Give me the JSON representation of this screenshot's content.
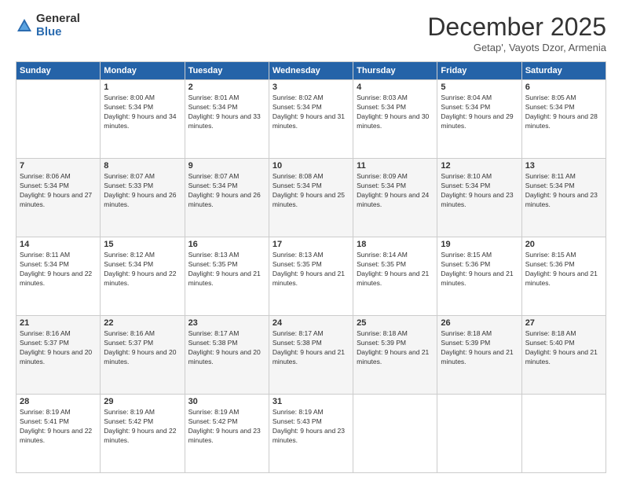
{
  "logo": {
    "general": "General",
    "blue": "Blue"
  },
  "title": "December 2025",
  "location": "Getap', Vayots Dzor, Armenia",
  "days_of_week": [
    "Sunday",
    "Monday",
    "Tuesday",
    "Wednesday",
    "Thursday",
    "Friday",
    "Saturday"
  ],
  "weeks": [
    [
      {
        "day": "",
        "sunrise": "",
        "sunset": "",
        "daylight": ""
      },
      {
        "day": "1",
        "sunrise": "Sunrise: 8:00 AM",
        "sunset": "Sunset: 5:34 PM",
        "daylight": "Daylight: 9 hours and 34 minutes."
      },
      {
        "day": "2",
        "sunrise": "Sunrise: 8:01 AM",
        "sunset": "Sunset: 5:34 PM",
        "daylight": "Daylight: 9 hours and 33 minutes."
      },
      {
        "day": "3",
        "sunrise": "Sunrise: 8:02 AM",
        "sunset": "Sunset: 5:34 PM",
        "daylight": "Daylight: 9 hours and 31 minutes."
      },
      {
        "day": "4",
        "sunrise": "Sunrise: 8:03 AM",
        "sunset": "Sunset: 5:34 PM",
        "daylight": "Daylight: 9 hours and 30 minutes."
      },
      {
        "day": "5",
        "sunrise": "Sunrise: 8:04 AM",
        "sunset": "Sunset: 5:34 PM",
        "daylight": "Daylight: 9 hours and 29 minutes."
      },
      {
        "day": "6",
        "sunrise": "Sunrise: 8:05 AM",
        "sunset": "Sunset: 5:34 PM",
        "daylight": "Daylight: 9 hours and 28 minutes."
      }
    ],
    [
      {
        "day": "7",
        "sunrise": "Sunrise: 8:06 AM",
        "sunset": "Sunset: 5:34 PM",
        "daylight": "Daylight: 9 hours and 27 minutes."
      },
      {
        "day": "8",
        "sunrise": "Sunrise: 8:07 AM",
        "sunset": "Sunset: 5:33 PM",
        "daylight": "Daylight: 9 hours and 26 minutes."
      },
      {
        "day": "9",
        "sunrise": "Sunrise: 8:07 AM",
        "sunset": "Sunset: 5:34 PM",
        "daylight": "Daylight: 9 hours and 26 minutes."
      },
      {
        "day": "10",
        "sunrise": "Sunrise: 8:08 AM",
        "sunset": "Sunset: 5:34 PM",
        "daylight": "Daylight: 9 hours and 25 minutes."
      },
      {
        "day": "11",
        "sunrise": "Sunrise: 8:09 AM",
        "sunset": "Sunset: 5:34 PM",
        "daylight": "Daylight: 9 hours and 24 minutes."
      },
      {
        "day": "12",
        "sunrise": "Sunrise: 8:10 AM",
        "sunset": "Sunset: 5:34 PM",
        "daylight": "Daylight: 9 hours and 23 minutes."
      },
      {
        "day": "13",
        "sunrise": "Sunrise: 8:11 AM",
        "sunset": "Sunset: 5:34 PM",
        "daylight": "Daylight: 9 hours and 23 minutes."
      }
    ],
    [
      {
        "day": "14",
        "sunrise": "Sunrise: 8:11 AM",
        "sunset": "Sunset: 5:34 PM",
        "daylight": "Daylight: 9 hours and 22 minutes."
      },
      {
        "day": "15",
        "sunrise": "Sunrise: 8:12 AM",
        "sunset": "Sunset: 5:34 PM",
        "daylight": "Daylight: 9 hours and 22 minutes."
      },
      {
        "day": "16",
        "sunrise": "Sunrise: 8:13 AM",
        "sunset": "Sunset: 5:35 PM",
        "daylight": "Daylight: 9 hours and 21 minutes."
      },
      {
        "day": "17",
        "sunrise": "Sunrise: 8:13 AM",
        "sunset": "Sunset: 5:35 PM",
        "daylight": "Daylight: 9 hours and 21 minutes."
      },
      {
        "day": "18",
        "sunrise": "Sunrise: 8:14 AM",
        "sunset": "Sunset: 5:35 PM",
        "daylight": "Daylight: 9 hours and 21 minutes."
      },
      {
        "day": "19",
        "sunrise": "Sunrise: 8:15 AM",
        "sunset": "Sunset: 5:36 PM",
        "daylight": "Daylight: 9 hours and 21 minutes."
      },
      {
        "day": "20",
        "sunrise": "Sunrise: 8:15 AM",
        "sunset": "Sunset: 5:36 PM",
        "daylight": "Daylight: 9 hours and 21 minutes."
      }
    ],
    [
      {
        "day": "21",
        "sunrise": "Sunrise: 8:16 AM",
        "sunset": "Sunset: 5:37 PM",
        "daylight": "Daylight: 9 hours and 20 minutes."
      },
      {
        "day": "22",
        "sunrise": "Sunrise: 8:16 AM",
        "sunset": "Sunset: 5:37 PM",
        "daylight": "Daylight: 9 hours and 20 minutes."
      },
      {
        "day": "23",
        "sunrise": "Sunrise: 8:17 AM",
        "sunset": "Sunset: 5:38 PM",
        "daylight": "Daylight: 9 hours and 20 minutes."
      },
      {
        "day": "24",
        "sunrise": "Sunrise: 8:17 AM",
        "sunset": "Sunset: 5:38 PM",
        "daylight": "Daylight: 9 hours and 21 minutes."
      },
      {
        "day": "25",
        "sunrise": "Sunrise: 8:18 AM",
        "sunset": "Sunset: 5:39 PM",
        "daylight": "Daylight: 9 hours and 21 minutes."
      },
      {
        "day": "26",
        "sunrise": "Sunrise: 8:18 AM",
        "sunset": "Sunset: 5:39 PM",
        "daylight": "Daylight: 9 hours and 21 minutes."
      },
      {
        "day": "27",
        "sunrise": "Sunrise: 8:18 AM",
        "sunset": "Sunset: 5:40 PM",
        "daylight": "Daylight: 9 hours and 21 minutes."
      }
    ],
    [
      {
        "day": "28",
        "sunrise": "Sunrise: 8:19 AM",
        "sunset": "Sunset: 5:41 PM",
        "daylight": "Daylight: 9 hours and 22 minutes."
      },
      {
        "day": "29",
        "sunrise": "Sunrise: 8:19 AM",
        "sunset": "Sunset: 5:42 PM",
        "daylight": "Daylight: 9 hours and 22 minutes."
      },
      {
        "day": "30",
        "sunrise": "Sunrise: 8:19 AM",
        "sunset": "Sunset: 5:42 PM",
        "daylight": "Daylight: 9 hours and 23 minutes."
      },
      {
        "day": "31",
        "sunrise": "Sunrise: 8:19 AM",
        "sunset": "Sunset: 5:43 PM",
        "daylight": "Daylight: 9 hours and 23 minutes."
      },
      {
        "day": "",
        "sunrise": "",
        "sunset": "",
        "daylight": ""
      },
      {
        "day": "",
        "sunrise": "",
        "sunset": "",
        "daylight": ""
      },
      {
        "day": "",
        "sunrise": "",
        "sunset": "",
        "daylight": ""
      }
    ]
  ]
}
